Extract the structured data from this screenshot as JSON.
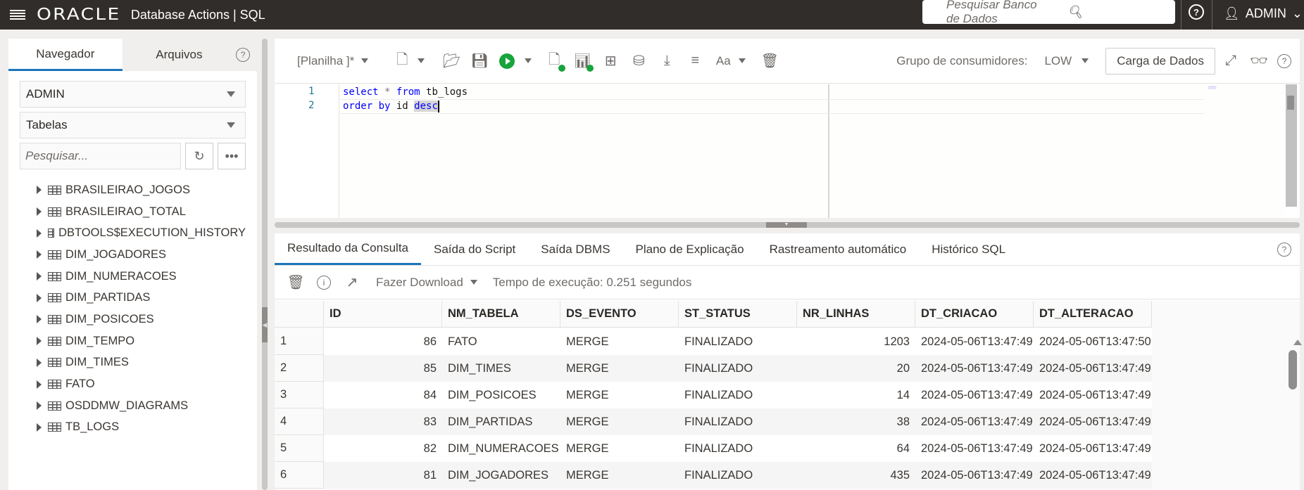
{
  "header": {
    "brand": "ORACLE",
    "app_title": "Database Actions |  SQL",
    "search_placeholder": "Pesquisar Banco de Dados",
    "user": "ADMIN"
  },
  "navigator": {
    "tabs": [
      {
        "label": "Navegador",
        "active": true
      },
      {
        "label": "Arquivos",
        "active": false
      }
    ],
    "schema": "ADMIN",
    "object_type": "Tabelas",
    "search_placeholder": "Pesquisar...",
    "tables": [
      "BRASILEIRAO_JOGOS",
      "BRASILEIRAO_TOTAL",
      "DBTOOLS$EXECUTION_HISTORY",
      "DIM_JOGADORES",
      "DIM_NUMERACOES",
      "DIM_PARTIDAS",
      "DIM_POSICOES",
      "DIM_TEMPO",
      "DIM_TIMES",
      "FATO",
      "OSDDMW_DIAGRAMS",
      "TB_LOGS"
    ]
  },
  "editor": {
    "worksheet": "[Planilha ]*",
    "consumer_group_label": "Grupo de consumidores:",
    "consumer_group": "LOW",
    "data_load": "Carga de Dados",
    "lines": [
      {
        "num": "1",
        "tokens": [
          [
            "kw",
            "select"
          ],
          [
            "",
            " "
          ],
          [
            "op",
            "*"
          ],
          [
            "",
            " "
          ],
          [
            "kw",
            "from"
          ],
          [
            "",
            " tb_logs"
          ]
        ]
      },
      {
        "num": "2",
        "tokens": [
          [
            "kw",
            "order"
          ],
          [
            "",
            " "
          ],
          [
            "kw",
            "by"
          ],
          [
            "",
            " id "
          ],
          [
            "kwsel",
            "desc"
          ]
        ]
      }
    ]
  },
  "results": {
    "tabs": [
      {
        "label": "Resultado da Consulta",
        "active": true
      },
      {
        "label": "Saída do Script",
        "active": false
      },
      {
        "label": "Saída DBMS",
        "active": false
      },
      {
        "label": "Plano de Explicação",
        "active": false
      },
      {
        "label": "Rastreamento automático",
        "active": false
      },
      {
        "label": "Histórico SQL",
        "active": false
      }
    ],
    "download": "Fazer Download",
    "exec_time": "Tempo de execução: 0.251 segundos",
    "columns": [
      "ID",
      "NM_TABELA",
      "DS_EVENTO",
      "ST_STATUS",
      "NR_LINHAS",
      "DT_CRIACAO",
      "DT_ALTERACAO"
    ],
    "rows": [
      [
        "1",
        "86",
        "FATO",
        "MERGE",
        "FINALIZADO",
        "1203",
        "2024-05-06T13:47:49.",
        "2024-05-06T13:47:50."
      ],
      [
        "2",
        "85",
        "DIM_TIMES",
        "MERGE",
        "FINALIZADO",
        "20",
        "2024-05-06T13:47:49.",
        "2024-05-06T13:47:49."
      ],
      [
        "3",
        "84",
        "DIM_POSICOES",
        "MERGE",
        "FINALIZADO",
        "14",
        "2024-05-06T13:47:49.",
        "2024-05-06T13:47:49."
      ],
      [
        "4",
        "83",
        "DIM_PARTIDAS",
        "MERGE",
        "FINALIZADO",
        "38",
        "2024-05-06T13:47:49.",
        "2024-05-06T13:47:49."
      ],
      [
        "5",
        "82",
        "DIM_NUMERACOES",
        "MERGE",
        "FINALIZADO",
        "64",
        "2024-05-06T13:47:49.",
        "2024-05-06T13:47:49."
      ],
      [
        "6",
        "81",
        "DIM_JOGADORES",
        "MERGE",
        "FINALIZADO",
        "435",
        "2024-05-06T13:47:49.",
        "2024-05-06T13:47:49."
      ]
    ]
  }
}
